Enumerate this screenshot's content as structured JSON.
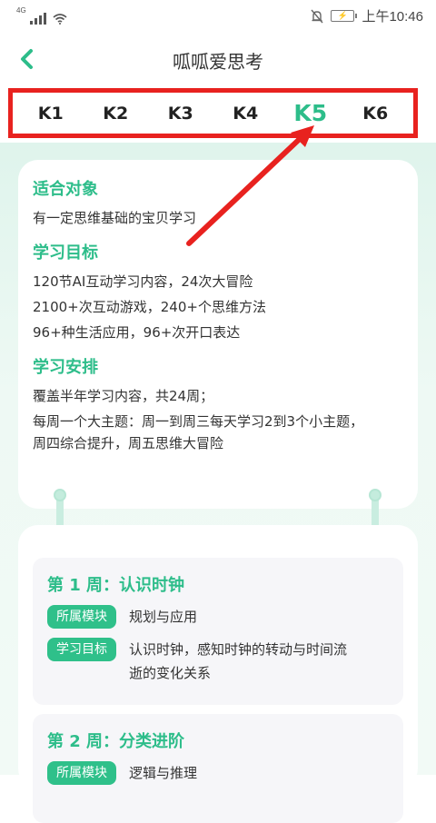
{
  "status_bar": {
    "network": "4G",
    "time": "上午10:46",
    "icons": [
      "signal-icon",
      "wifi-icon",
      "bell-off-icon",
      "battery-charging-icon"
    ]
  },
  "header": {
    "title": "呱呱爱思考",
    "back_icon": "chevron-left-icon"
  },
  "level_tabs": {
    "items": [
      {
        "label": "K1",
        "active": false
      },
      {
        "label": "K2",
        "active": false
      },
      {
        "label": "K3",
        "active": false
      },
      {
        "label": "K4",
        "active": false
      },
      {
        "label": "K5",
        "active": true
      },
      {
        "label": "K6",
        "active": false
      }
    ]
  },
  "info": {
    "target": {
      "title": "适合对象",
      "lines": [
        "有一定思维基础的宝贝学习"
      ]
    },
    "goals": {
      "title": "学习目标",
      "lines": [
        "120节AI互动学习内容，24次大冒险",
        "2100+次互动游戏，240+个思维方法",
        "96+种生活应用，96+次开口表达"
      ]
    },
    "schedule": {
      "title": "学习安排",
      "lines": [
        "覆盖半年学习内容，共24周；",
        "每周一个大主题：周一到周三每天学习2到3个小主题，",
        "周四综合提升，周五思维大冒险"
      ]
    }
  },
  "weeks": [
    {
      "title": "第 1 周：认识时钟",
      "module_tag": "所属模块",
      "module": "规划与应用",
      "goal_tag": "学习目标",
      "goal_lines": [
        "认识时钟，感知时钟的转动与时间流",
        "逝的变化关系"
      ]
    },
    {
      "title": "第 2 周：分类进阶",
      "module_tag": "所属模块",
      "module": "逻辑与推理"
    }
  ],
  "colors": {
    "accent": "#2dbd8a",
    "highlight_border": "#e8221f",
    "tag_bg": "#2fc08a"
  }
}
